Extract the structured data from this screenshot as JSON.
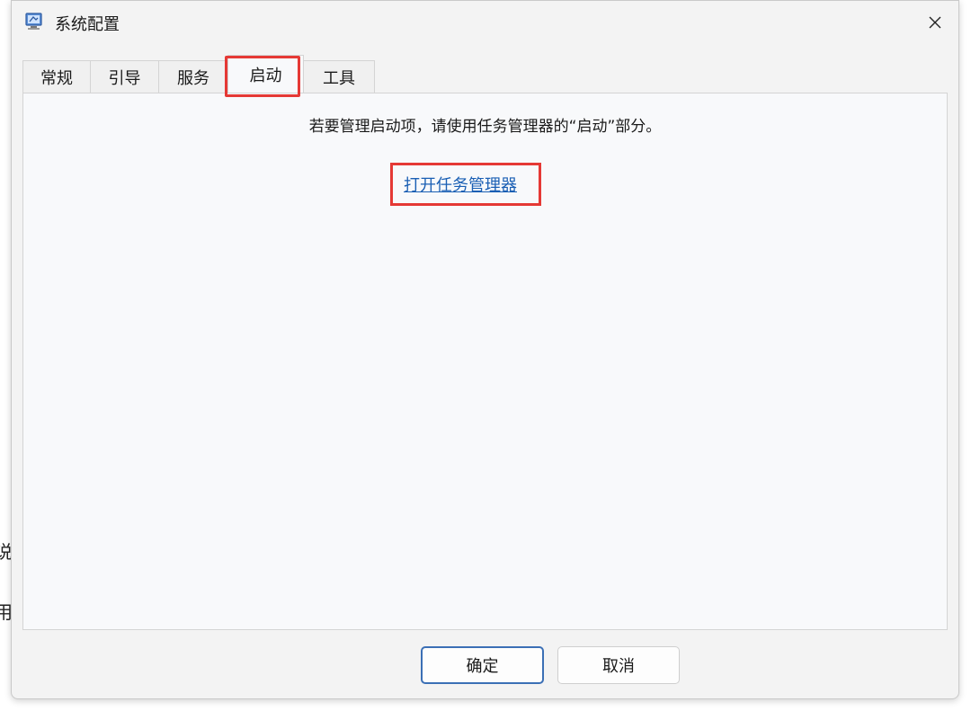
{
  "window": {
    "title": "系统配置",
    "icon": "msconfig-icon",
    "close_glyph": "✕"
  },
  "tabs": [
    {
      "label": "常规",
      "active": false
    },
    {
      "label": "引导",
      "active": false
    },
    {
      "label": "服务",
      "active": false
    },
    {
      "label": "启动",
      "active": true
    },
    {
      "label": "工具",
      "active": false
    }
  ],
  "startup_panel": {
    "instruction": "若要管理启动项，请使用任务管理器的“启动”部分。",
    "link_label": "打开任务管理器"
  },
  "buttons": {
    "ok_label": "确定",
    "cancel_label": "取消"
  },
  "background_fragments": [
    "说",
    "用"
  ],
  "colors": {
    "highlight": "#e53935",
    "link": "#1a5fb4",
    "primary_border": "#3b6fb5"
  }
}
